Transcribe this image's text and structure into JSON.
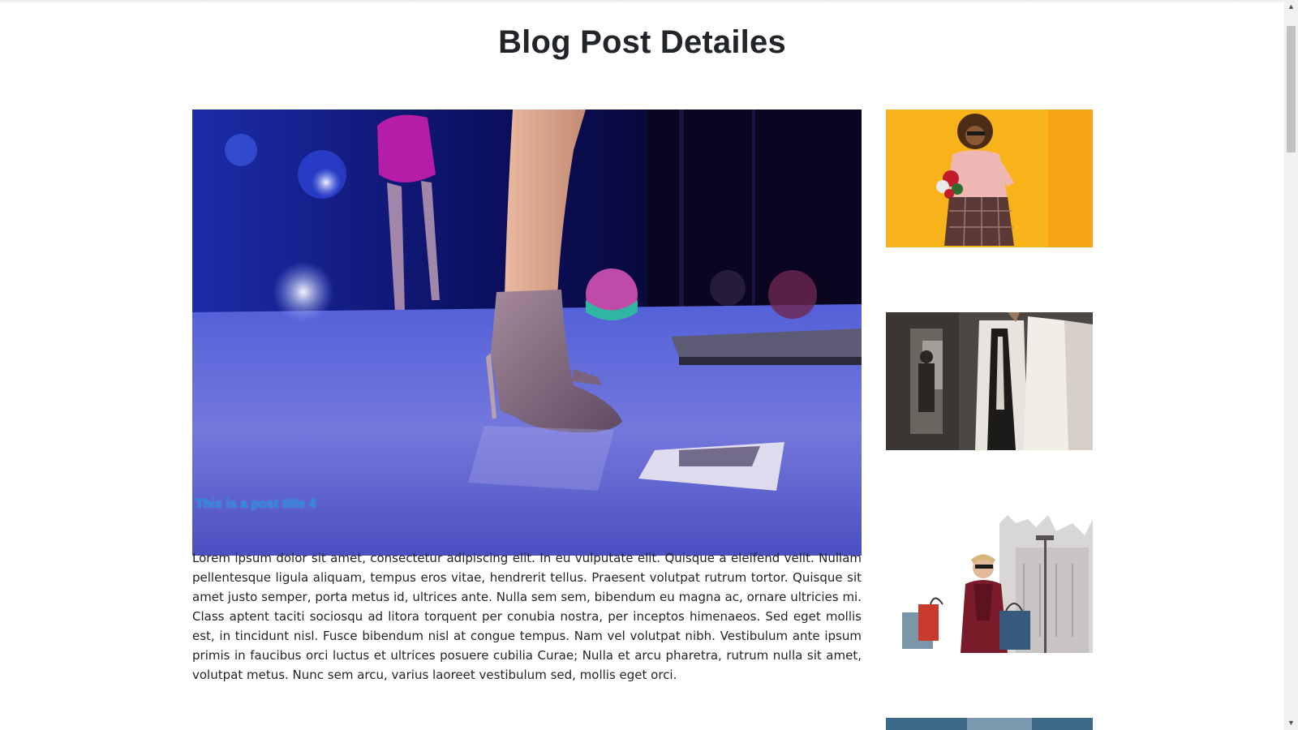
{
  "page": {
    "title": "Blog Post Detailes"
  },
  "post": {
    "title": "This is a post title 4",
    "body": "Lorem ipsum dolor sit amet, consectetur adipiscing elit. In eu vulputate elit. Quisque a eleifend velit. Nullam pellentesque ligula aliquam, tempus eros vitae, hendrerit tellus. Praesent volutpat rutrum tortor. Quisque sit amet justo semper, porta metus id, ultrices ante. Nulla sem sem, bibendum eu magna ac, ornare ultricies mi. Class aptent taciti sociosqu ad litora torquent per conubia nostra, per inceptos himenaeos. Sed eget mollis est, in tincidunt nisl. Fusce bibendum nisl at congue tempus. Nam vel volutpat nibh. Vestibulum ante ipsum primis in faucibus orci luctus et ultrices posuere cubilia Curae; Nulla et arcu pharetra, rutrum nulla sit amet, volutpat metus. Nunc sem arcu, varius laoreet vestibulum sed, mollis eget orci."
  },
  "colors": {
    "post_title": "#1a8fe6",
    "text": "#212529"
  },
  "sidebar": {
    "thumbnails": [
      {
        "icon": "photo-woman-yellow-background"
      },
      {
        "icon": "photo-clothing-rack"
      },
      {
        "icon": "photo-woman-shopping-bags"
      },
      {
        "icon": "photo-partial"
      }
    ]
  }
}
